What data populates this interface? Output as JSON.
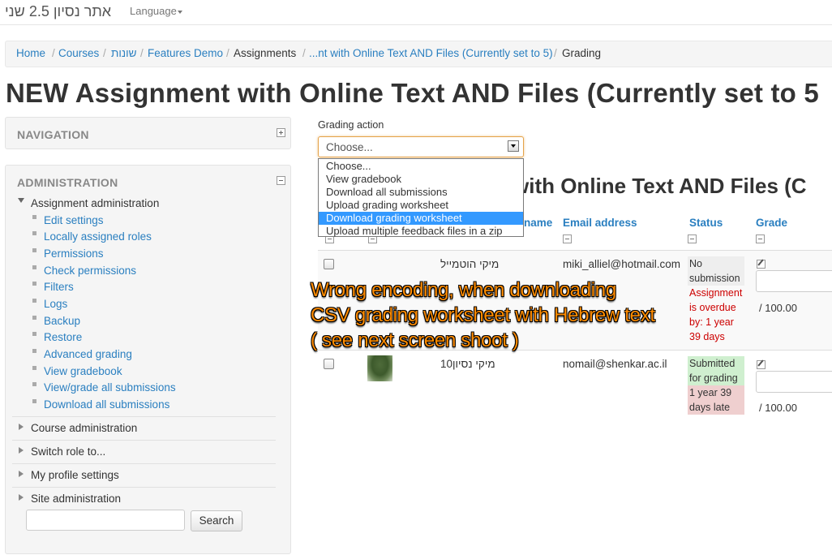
{
  "header": {
    "site_name": "אתר נסיון 2.5 שני",
    "language_label": "Language"
  },
  "breadcrumb": {
    "items": [
      "Home",
      "Courses",
      "שונות",
      "Features Demo",
      "Assignments",
      "...nt with Online Text AND Files (Currently set to 5)",
      "Grading"
    ],
    "separator": "/"
  },
  "page": {
    "title": "NEW Assignment with Online Text AND Files (Currently set to 5"
  },
  "navigation_block": {
    "title": "NAVIGATION"
  },
  "administration_block": {
    "title": "ADMINISTRATION",
    "assignment_admin": "Assignment administration",
    "assignment_items": [
      "Edit settings",
      "Locally assigned roles",
      "Permissions",
      "Check permissions",
      "Filters",
      "Logs",
      "Backup",
      "Restore",
      "Advanced grading",
      "View gradebook",
      "View/grade all submissions",
      "Download all submissions"
    ],
    "sections": [
      "Course administration",
      "Switch role to...",
      "My profile settings",
      "Site administration"
    ],
    "search_button": "Search",
    "search_value": ""
  },
  "grading": {
    "action_label": "Grading action",
    "selected": "Choose...",
    "options": [
      "Choose...",
      "View gradebook",
      "Download all submissions",
      "Upload grading worksheet",
      "Download grading worksheet",
      "Upload multiple feedback files in a zip"
    ],
    "highlighted_option": "Download grading worksheet",
    "section_title": "with Online Text AND Files (C"
  },
  "table": {
    "headers": {
      "name_partial": "name",
      "email": "Email address",
      "status": "Status",
      "grade": "Grade"
    },
    "rows": [
      {
        "name": "מיקי הוטמייל",
        "email": "miki_alliel@hotmail.com",
        "status_top": [
          "No",
          "submission"
        ],
        "status_bottom": [
          "Assignment",
          "is overdue",
          "by: 1 year",
          "39 days"
        ],
        "grade_out_of": "/ 100.00"
      },
      {
        "name": "מיקי נסיון10",
        "email": "nomail@shenkar.ac.il",
        "status_top": [
          "Submitted",
          "for grading"
        ],
        "status_bottom": [
          "1 year 39",
          "days late"
        ],
        "grade_out_of": "/ 100.00"
      }
    ]
  },
  "annotation": {
    "lines": [
      "Wrong encoding, when downloading",
      "CSV grading worksheet with Hebrew text",
      "( see next screen shoot )"
    ],
    "color": "#ff8c00"
  },
  "colors": {
    "link": "#2a7fc0",
    "selected_option": "#3399ff",
    "submitted_bg": "#cfefcf",
    "late_bg": "#efcfcf",
    "overdue_text": "#cc0000"
  }
}
